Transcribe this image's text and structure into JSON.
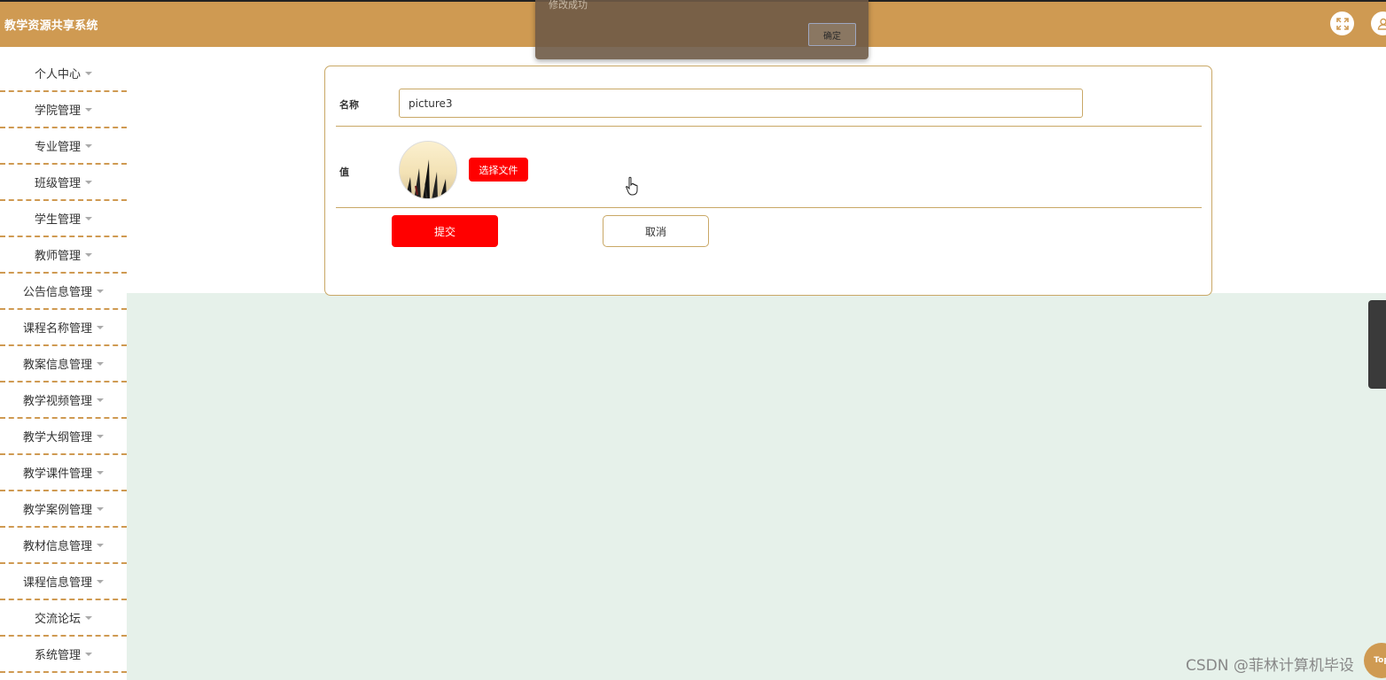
{
  "header": {
    "app_title": "教学资源共享系统",
    "icons": [
      "fullscreen-icon",
      "user-icon"
    ]
  },
  "toast": {
    "message": "修改成功",
    "confirm_label": "确定"
  },
  "sidebar": {
    "items": [
      {
        "label": "个人中心"
      },
      {
        "label": "学院管理"
      },
      {
        "label": "专业管理"
      },
      {
        "label": "班级管理"
      },
      {
        "label": "学生管理"
      },
      {
        "label": "教师管理"
      },
      {
        "label": "公告信息管理"
      },
      {
        "label": "课程名称管理"
      },
      {
        "label": "教案信息管理"
      },
      {
        "label": "教学视频管理"
      },
      {
        "label": "教学大纲管理"
      },
      {
        "label": "教学课件管理"
      },
      {
        "label": "教学案例管理"
      },
      {
        "label": "教材信息管理"
      },
      {
        "label": "课程信息管理"
      },
      {
        "label": "交流论坛"
      },
      {
        "label": "系统管理"
      }
    ]
  },
  "form": {
    "name_label": "名称",
    "name_value": "picture3",
    "value_label": "值",
    "choose_file_label": "选择文件",
    "submit_label": "提交",
    "cancel_label": "取消"
  },
  "footer": {
    "watermark": "CSDN @菲林计算机毕设",
    "top_label": "Top"
  },
  "colors": {
    "brand": "#cf9a52",
    "primary_button": "#ff0000",
    "content_bg": "#e6f1ea"
  }
}
